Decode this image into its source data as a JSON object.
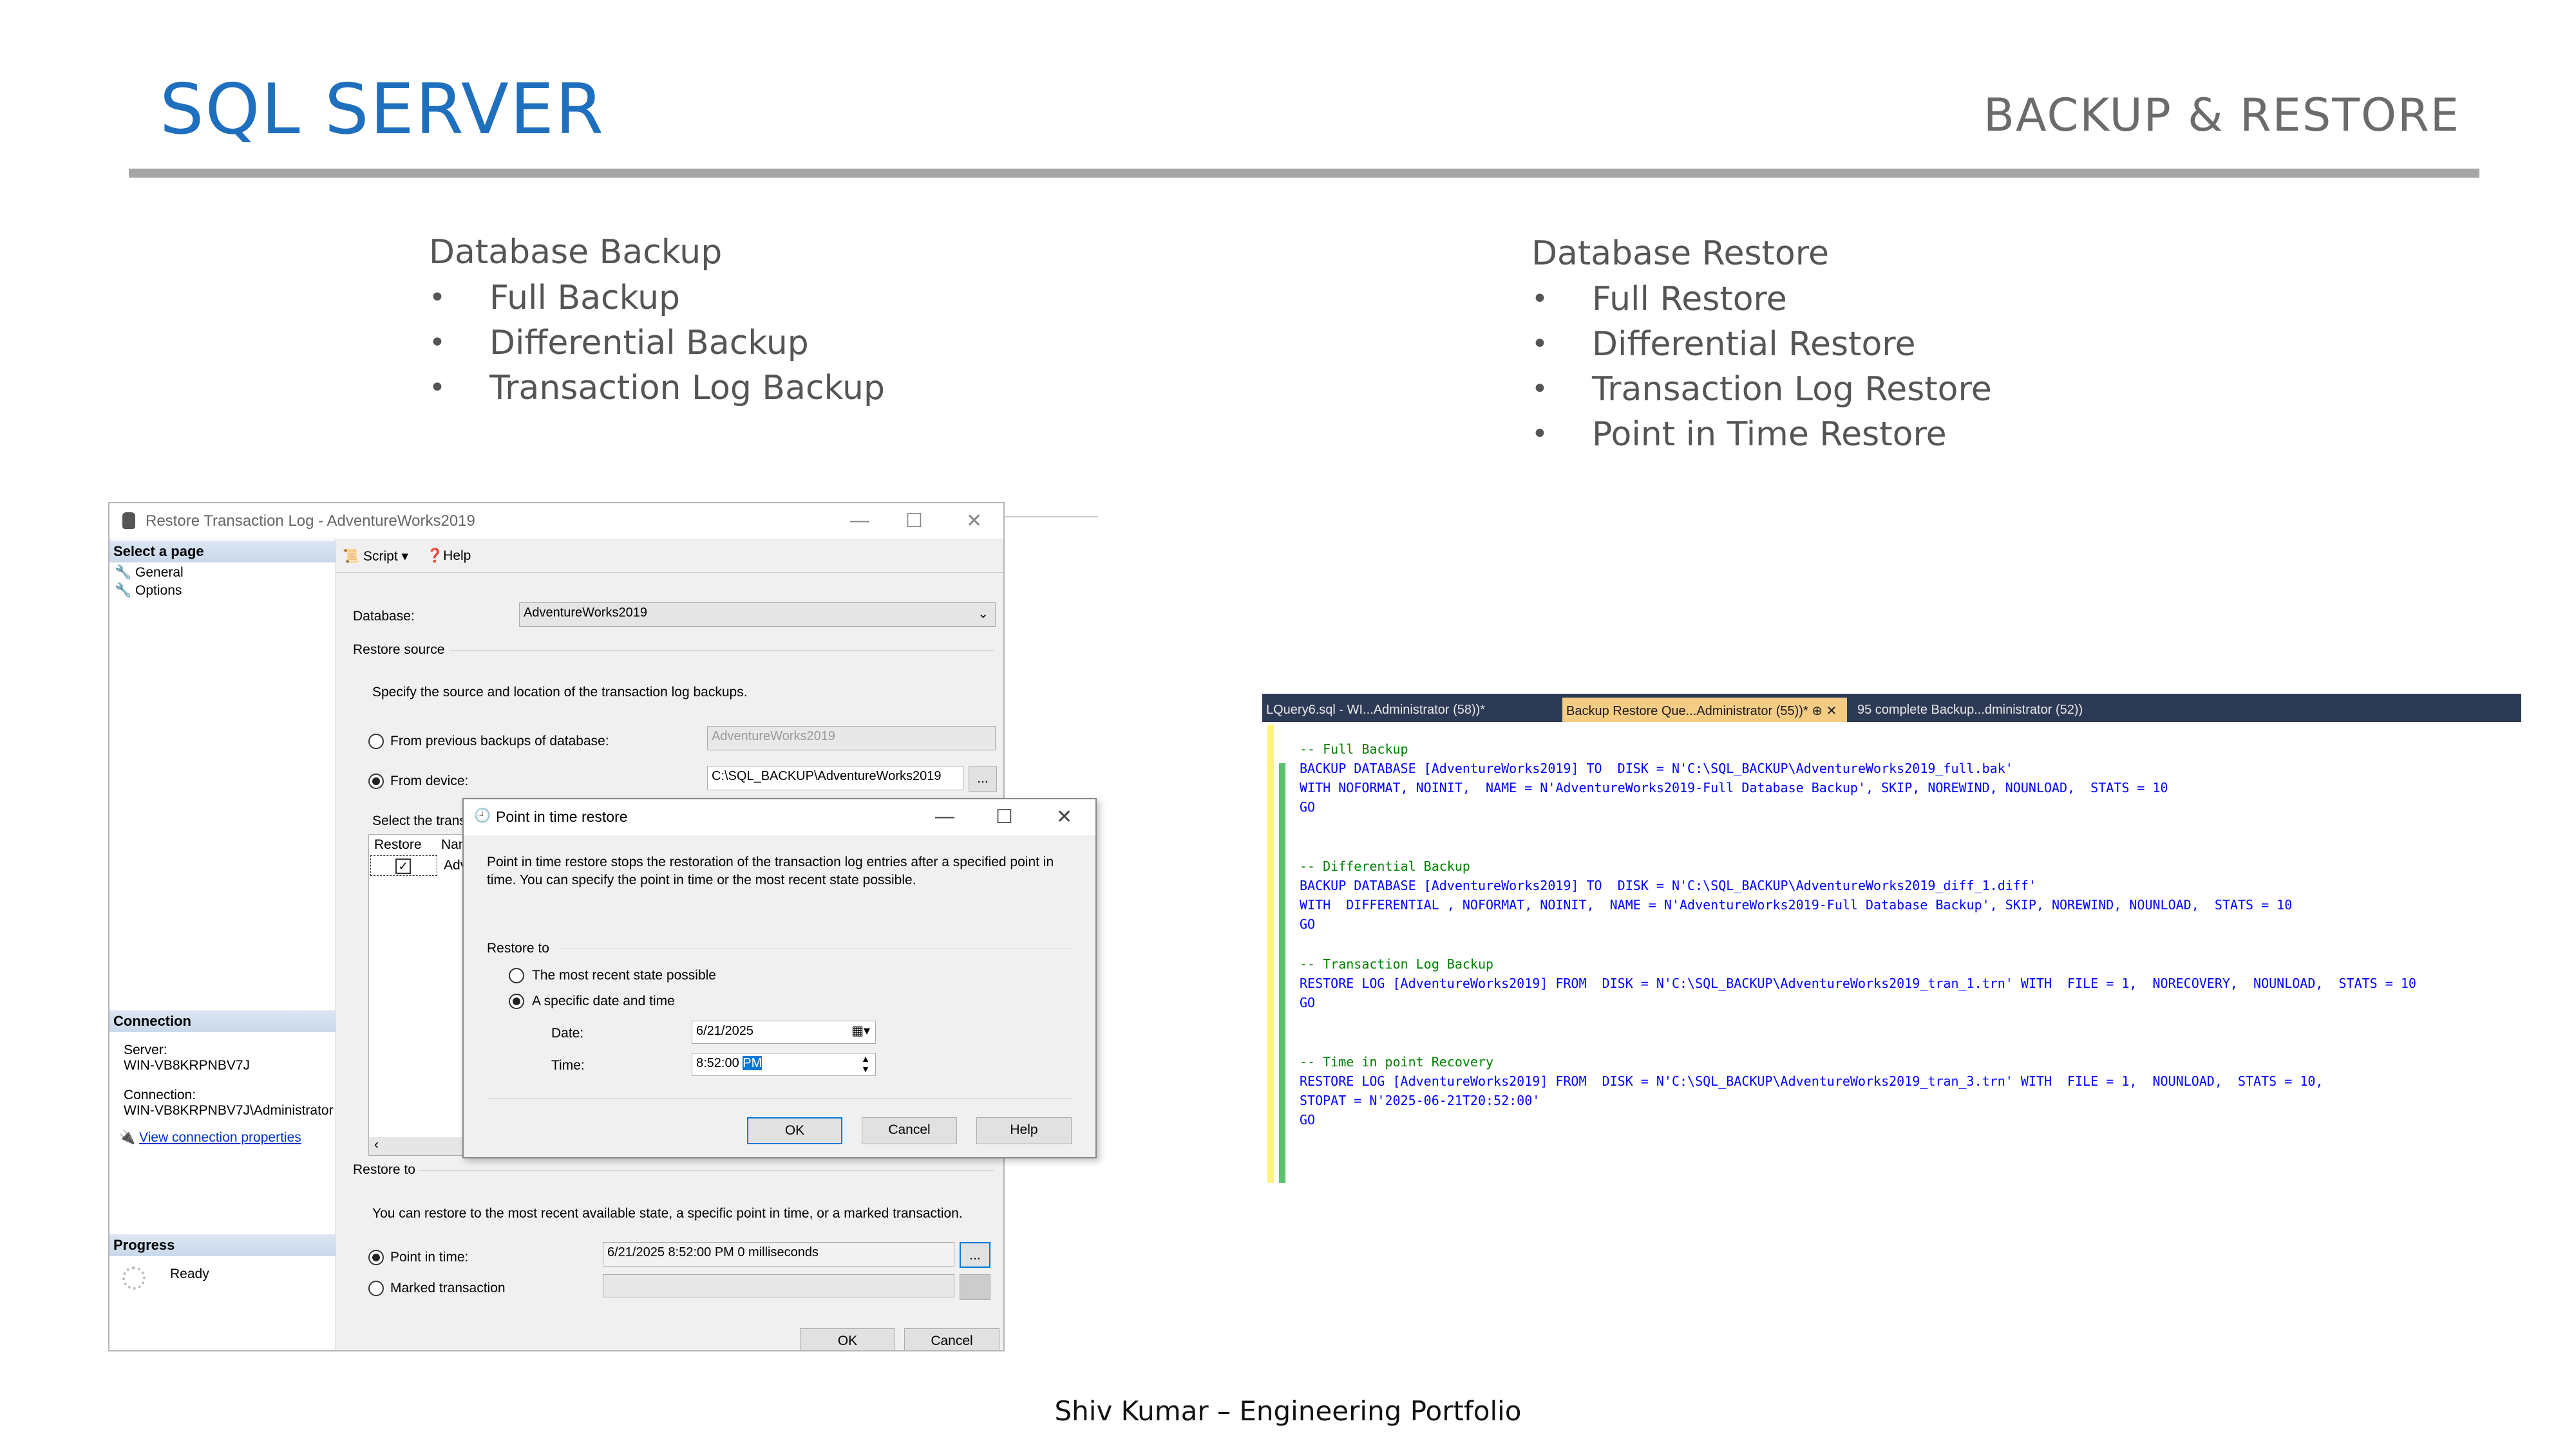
{
  "slide": {
    "title": "SQL SERVER",
    "subtitle": "BACKUP & RESTORE",
    "footer": "Shiv Kumar – Engineering Portfolio"
  },
  "backup": {
    "heading": "Database Backup",
    "items": [
      "Full Backup",
      "Differential Backup",
      "Transaction Log Backup"
    ]
  },
  "restore": {
    "heading": "Database Restore",
    "items": [
      "Full Restore",
      "Differential Restore",
      "Transaction Log Restore",
      "Point in Time Restore"
    ]
  },
  "bullet_glyph": "•",
  "restore_window": {
    "title": "Restore Transaction Log  -  AdventureWorks2019",
    "left_pane": {
      "select_page": "Select a page",
      "pages": [
        "General",
        "Options"
      ],
      "connection_head": "Connection",
      "server_label": "Server:",
      "server_value": "WIN-VB8KRPNBV7J",
      "connection_label": "Connection:",
      "connection_value": "WIN-VB8KRPNBV7J\\Administrator",
      "view_props": "View connection properties",
      "progress_head": "Progress",
      "progress_status": "Ready"
    },
    "toolbar": {
      "script": "Script",
      "help": "Help"
    },
    "database_label": "Database:",
    "database_value": "AdventureWorks2019",
    "restore_source": "Restore source",
    "specify_text": "Specify the source and location of the transaction log backups.",
    "from_previous": "From previous backups of database:",
    "from_previous_value": "AdventureWorks2019",
    "from_device": "From device:",
    "device_path": "C:\\SQL_BACKUP\\AdventureWorks2019",
    "select_trans": "Select the trans",
    "grid_cols": [
      "Restore",
      "Nam"
    ],
    "grid_row_name": "Adv",
    "restore_to": "Restore to",
    "restore_to_text": "You can restore to the most recent available state, a specific point in time, or a marked transaction.",
    "point_in_time": "Point in time:",
    "point_in_time_value": "6/21/2025 8:52:00 PM 0 milliseconds",
    "marked_transaction": "Marked transaction",
    "ok": "OK",
    "cancel": "Cancel",
    "ellipsis": "..."
  },
  "pit_dialog": {
    "title": "Point in time restore",
    "description": "Point in time restore stops the restoration of the transaction log entries after a specified point in time. You can specify the point in time or the most recent state possible.",
    "restore_to": "Restore to",
    "option_recent": "The most recent state possible",
    "option_specific": "A specific date and time",
    "date_label": "Date:",
    "date_value": "6/21/2025",
    "time_label": "Time:",
    "time_value": "8:52:00",
    "time_ampm": "PM",
    "ok": "OK",
    "cancel": "Cancel",
    "help": "Help"
  },
  "editor": {
    "tabs": [
      "LQuery6.sql - WI...Administrator (58))*",
      "Backup Restore Que...Administrator (55))*",
      "95 complete Backup...dministrator (52))"
    ],
    "lines": {
      "c1": "-- Full Backup",
      "l1a": "BACKUP DATABASE [AdventureWorks2019] TO  DISK = N'C:\\SQL_BACKUP\\AdventureWorks2019_full.bak'",
      "l1b": "WITH NOFORMAT, NOINIT,  NAME = N'AdventureWorks2019-Full Database Backup', SKIP, NOREWIND, NOUNLOAD,  STATS = 10",
      "go": "GO",
      "c2": "-- Differential Backup",
      "l2a": "BACKUP DATABASE [AdventureWorks2019] TO  DISK = N'C:\\SQL_BACKUP\\AdventureWorks2019_diff_1.diff'",
      "l2b": "WITH  DIFFERENTIAL , NOFORMAT, NOINIT,  NAME = N'AdventureWorks2019-Full Database Backup', SKIP, NOREWIND, NOUNLOAD,  STATS = 10",
      "c3": "-- Transaction Log Backup",
      "l3a": "RESTORE LOG [AdventureWorks2019] FROM  DISK = N'C:\\SQL_BACKUP\\AdventureWorks2019_tran_1.trn' WITH  FILE = 1,  NORECOVERY,  NOUNLOAD,  STATS = 10",
      "c4": "-- Time in point Recovery",
      "l4a": "RESTORE LOG [AdventureWorks2019] FROM  DISK = N'C:\\SQL_BACKUP\\AdventureWorks2019_tran_3.trn' WITH  FILE = 1,  NOUNLOAD,  STATS = 10,",
      "l4b": "STOPAT = N'2025-06-21T20:52:00'"
    }
  },
  "colors": {
    "title_blue": "#1f6fbf",
    "rule_gray": "#a5a5a5",
    "keyword": "#0000ff",
    "comment": "#008000",
    "string": "#d00000"
  }
}
